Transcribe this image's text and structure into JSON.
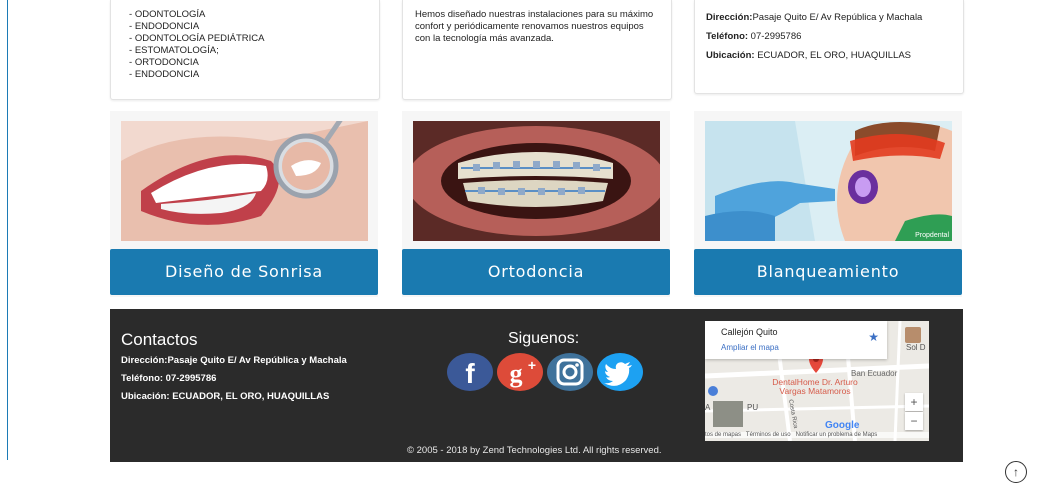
{
  "services": {
    "items": [
      "ODONTOLOGÍA",
      "ENDODONCIA",
      "ODONTOLOGÍA PEDIÁTRICA",
      "ESTOMATOLOGÍA;",
      "ORTODONCIA",
      "ENDODONCIA"
    ]
  },
  "facilities": {
    "text": "Hemos diseñado nuestras instalaciones para su máximo confort y periódicamente renovamos nuestros equipos con la tecnología más avanzada."
  },
  "contact_top": {
    "address_label": "Dirección:",
    "address": "Pasaje Quito E/ Av República y Machala",
    "phone_label": "Teléfono:",
    "phone": " 07-2995786",
    "location_label": "Ubicación:",
    "location": " ECUADOR, EL ORO, HUAQUILLAS"
  },
  "tiles": [
    {
      "label": "Diseño de Sonrisa",
      "image": "smile-photo"
    },
    {
      "label": "Ortodoncia",
      "image": "braces-photo"
    },
    {
      "label": "Blanqueamiento",
      "image": "whitening-photo",
      "watermark": "Propdental"
    }
  ],
  "footer": {
    "title": "Contactos",
    "address": "Dirección:Pasaje Quito E/ Av República y Machala",
    "phone": "Teléfono: 07-2995786",
    "location": "Ubicación: ECUADOR, EL ORO, HUAQUILLAS",
    "social_title": "Siguenos:",
    "social": [
      "facebook-icon",
      "google-plus-icon",
      "instagram-icon",
      "twitter-icon"
    ],
    "copyright": "© 2005 - 2018 by Zend Technologies Ltd. All rights reserved."
  },
  "map": {
    "place": "Callejón Quito",
    "enlarge": "Ampliar el mapa",
    "label_bank": "Ban Ecuador",
    "label_clinic": "DentalHome Dr. Arturo Vargas Matamoros",
    "label_sol": "Sol D",
    "label_street": "Costa Rica",
    "label_left": "A",
    "label_left2": "PU",
    "label_google": "Google",
    "footer_text": "tos de mapas   Términos de uso   Notificar un problema de Maps",
    "zoom_in": "+",
    "zoom_out": "−"
  },
  "colors": {
    "accent": "#1a7ab0",
    "footer_bg": "#2b2b2b",
    "facebook": "#3b5998",
    "google": "#dd4b39",
    "instagram": "#3f729b",
    "twitter": "#1da1f2"
  }
}
